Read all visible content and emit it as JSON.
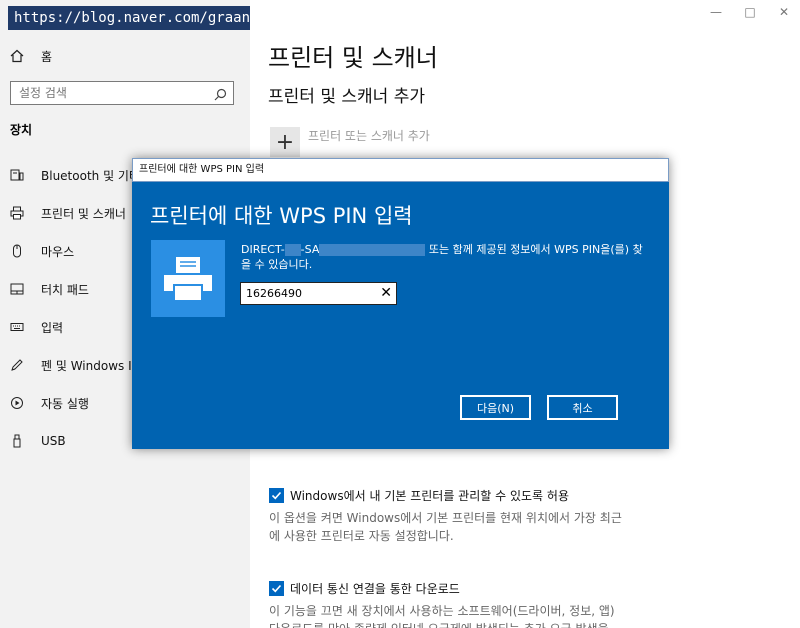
{
  "watermark": {
    "text": "https://blog.naver.com/graandayay"
  },
  "window": {
    "minimize_glyph": "—",
    "maximize_glyph": "□",
    "close_glyph": "✕"
  },
  "sidebar": {
    "home_label": "홈",
    "search_placeholder": "설정 검색",
    "section_title": "장치",
    "items": [
      {
        "label": "Bluetooth 및 기타 장치",
        "icon": "bluetooth-device-icon"
      },
      {
        "label": "프린터 및 스캐너",
        "icon": "printer-icon"
      },
      {
        "label": "마우스",
        "icon": "mouse-icon"
      },
      {
        "label": "터치 패드",
        "icon": "touchpad-icon"
      },
      {
        "label": "입력",
        "icon": "keyboard-icon"
      },
      {
        "label": "펜 및 Windows Ink",
        "icon": "pen-icon"
      },
      {
        "label": "자동 실행",
        "icon": "autoplay-icon"
      },
      {
        "label": "USB",
        "icon": "usb-icon"
      }
    ]
  },
  "main": {
    "title": "프린터 및 스캐너",
    "subtitle": "프린터 및 스캐너 추가",
    "add_label": "프린터 또는 스캐너 추가",
    "options": [
      {
        "label": "Windows에서 내 기본 프린터를 관리할 수 있도록 허용",
        "checked": true,
        "desc1": "이 옵션을 켜면 Windows에서 기본 프린터를 현재 위치에서 가장 최근",
        "desc2": "에 사용한 프린터로 자동 설정합니다."
      },
      {
        "label": "데이터 통신 연결을 통한 다운로드",
        "checked": true,
        "desc1": "이 기능을 끄면 새 장치에서 사용하는 소프트웨어(드라이버, 정보, 앱)",
        "desc2": "다운로드를 막아 종량제 인터넷 요금제에 발생되는 추가 요금 발생을"
      }
    ]
  },
  "dialog": {
    "titlebar": "프린터에 대한 WPS PIN 입력",
    "heading": "프린터에 대한 WPS PIN 입력",
    "device_prefix": "DIRECT-",
    "device_mid": "-SA",
    "message_rest": "또는 함께 제공된 정보에서 WPS PIN을(를) 찾",
    "message_line2": "을 수 있습니다.",
    "pin_value": "16266490",
    "next_label": "다음(N)",
    "cancel_label": "취소"
  },
  "colors": {
    "accent": "#0063b1",
    "tile": "#2b8fe3",
    "checkbox": "#0067c0",
    "sidebar_bg": "#f2f2f2"
  }
}
